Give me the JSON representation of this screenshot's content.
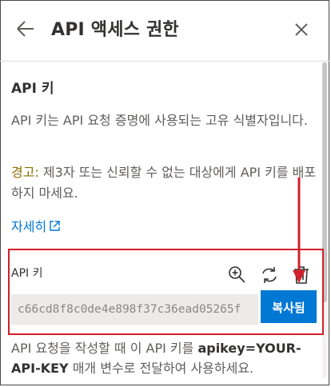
{
  "header": {
    "title": "API 액세스 권한",
    "back_icon": "back-arrow-icon",
    "close_icon": "close-icon"
  },
  "section": {
    "title": "API 키"
  },
  "description": "API 키는 API 요청 증명에 사용되는 고유 식별자입니다.",
  "warning": {
    "label": "경고:",
    "text": " 제3자 또는 신뢰할 수 없는 대상에게 API 키를 배포하지 마세요."
  },
  "learn_more": {
    "label": "자세히",
    "icon": "external-link-icon"
  },
  "key_panel": {
    "label": "API 키",
    "value": "c66cd8f8c0de4e898f37c36ead05265f",
    "copy_button": "복사됨",
    "icons": [
      "zoom-in-icon",
      "regenerate-icon",
      "delete-icon"
    ]
  },
  "note": {
    "prefix": "API 요청을 작성할 때 이 API 키를 ",
    "param": "apikey=YOUR-API-KEY",
    "suffix": " 매개 변수로 전달하여 사용하세요."
  },
  "colors": {
    "accent": "#0078d4",
    "warning": "#8a6d00",
    "highlight": "#d21f2b"
  }
}
